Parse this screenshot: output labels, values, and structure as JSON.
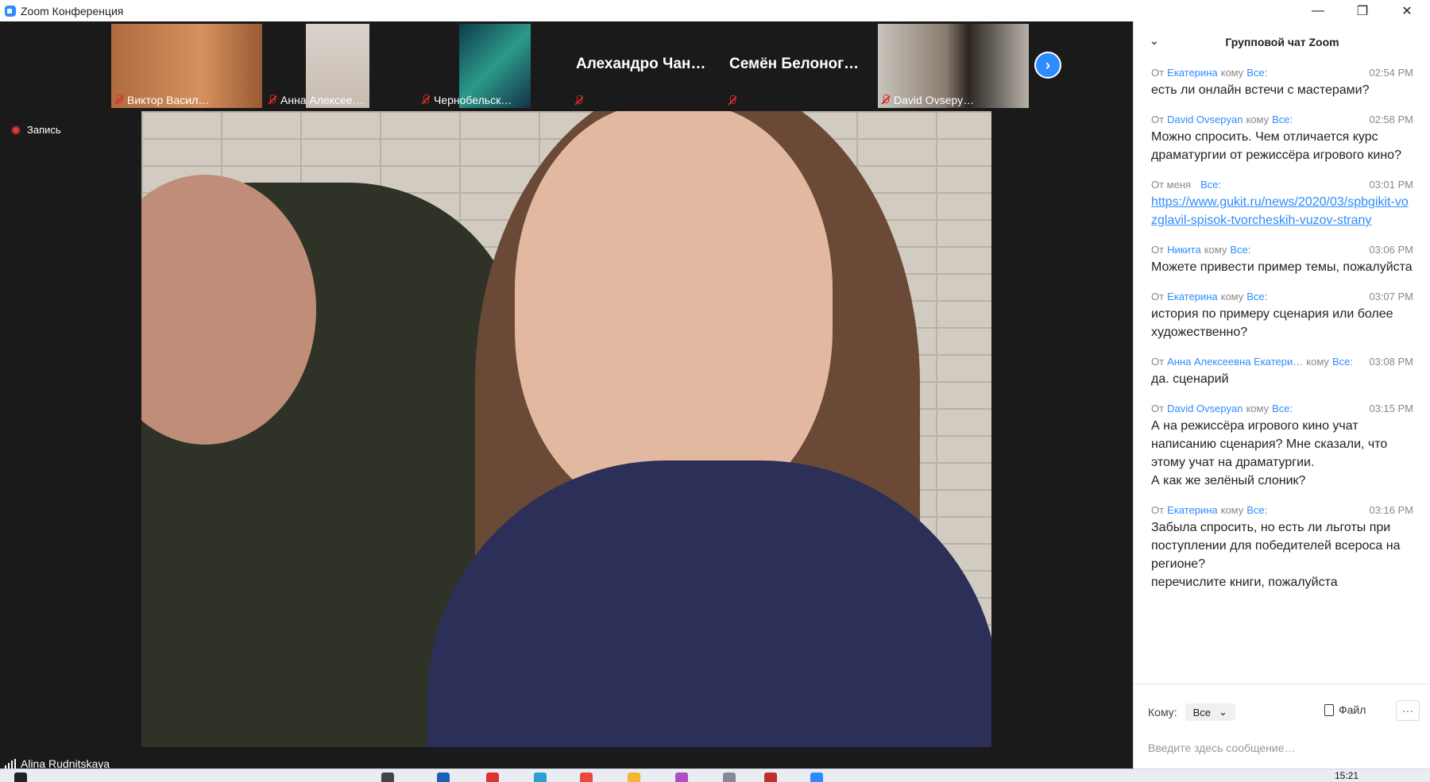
{
  "window": {
    "title": "Zoom Конференция",
    "minimize": "—",
    "restore": "❐",
    "close": "✕"
  },
  "participants": [
    {
      "name": "Виктор Васил…",
      "type": "video"
    },
    {
      "name": "Анна Алексее…",
      "type": "video"
    },
    {
      "name": "Чернобельск…",
      "type": "video"
    },
    {
      "name": "Алехандро Чан…",
      "type": "name"
    },
    {
      "name": "Семён Белоног…",
      "type": "name"
    },
    {
      "name": "David Ovsepy…",
      "type": "video"
    }
  ],
  "next_button": "›",
  "recording": {
    "label": "Запись"
  },
  "active_speaker": {
    "name": "Alina Rudnitskaya"
  },
  "chat": {
    "title": "Групповой чат Zoom",
    "messages": [
      {
        "from_label": "От",
        "sender": "Екатерина",
        "to_label": "кому",
        "recipient": "Все:",
        "time": "02:54 PM",
        "text": "есть ли онлайн встечи с  мастерами?"
      },
      {
        "from_label": "От",
        "sender": "David Ovsepyan",
        "to_label": "кому",
        "recipient": "Все:",
        "time": "02:58 PM",
        "text": "Можно спросить. Чем отличается курс драматургии от режиссёра игрового кино?"
      },
      {
        "from_label": "От меня",
        "sender": "",
        "to_label": "",
        "recipient": "Все:",
        "time": "03:01 PM",
        "text": "https://www.gukit.ru/news/2020/03/spbgikit-vozglavil-spisok-tvorcheskih-vuzov-strany",
        "is_link": true
      },
      {
        "from_label": "От",
        "sender": "Никита",
        "to_label": "кому",
        "recipient": "Все:",
        "time": "03:06 PM",
        "text": "Можете привести пример темы, пожалуйста"
      },
      {
        "from_label": "От",
        "sender": "Екатерина",
        "to_label": "кому",
        "recipient": "Все:",
        "time": "03:07 PM",
        "text": "история по примеру сценария или более художественно?"
      },
      {
        "from_label": "От",
        "sender": "Анна Алексеевна Екатери…",
        "to_label": "кому",
        "recipient": "Все:",
        "time": "03:08 PM",
        "text": "да. сценарий"
      },
      {
        "from_label": "От",
        "sender": "David Ovsepyan",
        "to_label": "кому",
        "recipient": "Все:",
        "time": "03:15 PM",
        "text": "А на режиссёра игрового кино учат написанию сценария? Мне сказали, что этому учат на драматургии.\nА как же зелёный слоник?"
      },
      {
        "from_label": "От",
        "sender": "Екатерина",
        "to_label": "кому",
        "recipient": "Все:",
        "time": "03:16 PM",
        "text": "Забыла спросить, но есть ли льготы при поступлении для победителей всероса на регионе?\nперечислите книги, пожалуйста"
      }
    ],
    "composer": {
      "to_label": "Кому:",
      "to_value": "Все",
      "file_label": "Файл",
      "more_label": "···",
      "placeholder": "Введите здесь сообщение…"
    }
  },
  "taskbar": {
    "clock": "15:21"
  },
  "colors": {
    "accent": "#2d8cff",
    "background": "#1a1a1a",
    "muted_mic": "#e02828"
  }
}
